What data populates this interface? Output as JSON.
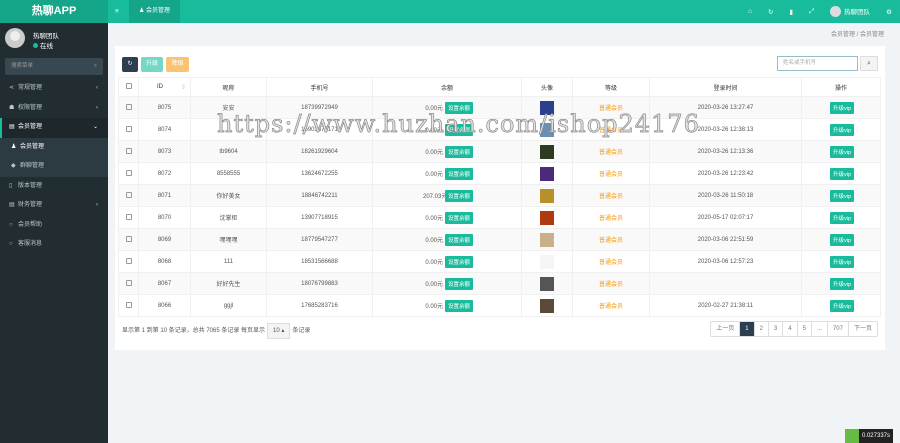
{
  "app": {
    "title": "热聊APP"
  },
  "user": {
    "name": "热聊团队",
    "status": "在线"
  },
  "sidebar": {
    "search_placeholder": "搜索菜单",
    "items": [
      {
        "label": "常规管理",
        "icon": "share-icon",
        "arrow": "‹"
      },
      {
        "label": "权限管理",
        "icon": "users-icon",
        "arrow": "‹"
      },
      {
        "label": "会员管理",
        "icon": "list-icon",
        "arrow": "⌄"
      },
      {
        "label": "会员管理",
        "icon": "user-icon"
      },
      {
        "label": "群聊管理",
        "icon": "comments-icon"
      },
      {
        "label": "版本管理",
        "icon": "file-icon"
      },
      {
        "label": "财务管理",
        "icon": "list-icon",
        "arrow": "‹"
      },
      {
        "label": "会员帮助",
        "icon": "circle-icon"
      },
      {
        "label": "客服消息",
        "icon": "circle-icon"
      }
    ]
  },
  "header": {
    "tab": "会员管理",
    "user": "热聊团队"
  },
  "breadcrumb": [
    "会员管理",
    "/",
    "会员管理"
  ],
  "toolbar": {
    "upgrade": "升级",
    "downgrade": "降级",
    "search_placeholder": "姓名或手机号"
  },
  "table": {
    "columns": [
      "ID",
      "昵称",
      "手机号",
      "余额",
      "头像",
      "等级",
      "登录时间",
      "操作"
    ],
    "set_balance": "设置余额",
    "upgrade_vip": "升级vip",
    "rows": [
      {
        "id": "8075",
        "nick": "安安",
        "phone": "18739972949",
        "balance": "0.00元",
        "level": "普通会员",
        "time": "2020-03-26 13:27:47",
        "face": "#2a3f8f"
      },
      {
        "id": "8074",
        "nick": "",
        "phone": "15903672171",
        "balance": "0.00元",
        "level": "普通会员",
        "time": "2020-03-26 12:38:13",
        "face": "#6a8fb0"
      },
      {
        "id": "8073",
        "nick": "tb9604",
        "phone": "18261929604",
        "balance": "0.00元",
        "level": "普通会员",
        "time": "2020-03-26 12:13:36",
        "face": "#2f3a22"
      },
      {
        "id": "8072",
        "nick": "8558555",
        "phone": "13624672255",
        "balance": "0.00元",
        "level": "普通会员",
        "time": "2020-03-26 12:23:42",
        "face": "#4b2a7a"
      },
      {
        "id": "8071",
        "nick": "你好美女",
        "phone": "18846742211",
        "balance": "207.03元",
        "level": "普通会员",
        "time": "2020-03-26 11:50:18",
        "face": "#b8902a"
      },
      {
        "id": "8070",
        "nick": "沈掌柜",
        "phone": "13907718915",
        "balance": "0.00元",
        "level": "普通会员",
        "time": "2020-05-17 02:07:17",
        "face": "#b03a10"
      },
      {
        "id": "8069",
        "nick": "嘿嘿嘿",
        "phone": "18779547277",
        "balance": "0.00元",
        "level": "普通会员",
        "time": "2020-03-06 22:51:59",
        "face": "#c9b08a"
      },
      {
        "id": "8068",
        "nick": "111",
        "phone": "18531566688",
        "balance": "0.00元",
        "level": "普通会员",
        "time": "2020-03-06 12:57:23",
        "face": "#f3f6f3"
      },
      {
        "id": "8067",
        "nick": "好好先生",
        "phone": "18076799883",
        "balance": "0.00元",
        "level": "普通会员",
        "time": "",
        "face": "#555"
      },
      {
        "id": "8066",
        "nick": "ggjl",
        "phone": "17685283716",
        "balance": "0.00元",
        "level": "普通会员",
        "time": "2020-02-27 21:38:11",
        "face": "#5a4a3a"
      }
    ]
  },
  "footer": {
    "info": "显示第 1 到第 10 条记录，总共 7065 条记录 每页显示",
    "page_size": "10 ▴",
    "suffix": "条记录"
  },
  "pager": [
    "上一页",
    "1",
    "2",
    "3",
    "4",
    "5",
    "...",
    "707",
    "下一页"
  ],
  "watermark": "https://www.huzhan.com/ishop24176",
  "badge": "0.027337s"
}
